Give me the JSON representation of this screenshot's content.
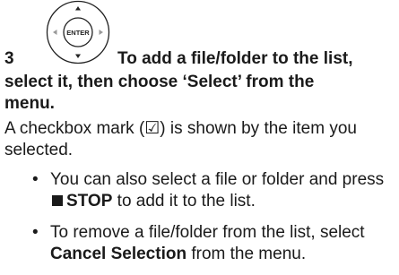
{
  "step": {
    "number": "3",
    "heading_line1": "To add a file/folder to the list,",
    "heading_line2": "select it, then choose ‘Select’ from the",
    "heading_line3": "menu.",
    "remote_button_label": "ENTER"
  },
  "body": {
    "text": "A checkbox mark (☑) is shown by the item you selected."
  },
  "bullets": [
    {
      "before": "You can also select a file or folder and press ",
      "emphasis": "STOP",
      "after": " to add it to the list."
    },
    {
      "before": "To remove a file/folder from the list, select ",
      "emphasis": "Cancel Selection",
      "after": " from the menu."
    }
  ]
}
